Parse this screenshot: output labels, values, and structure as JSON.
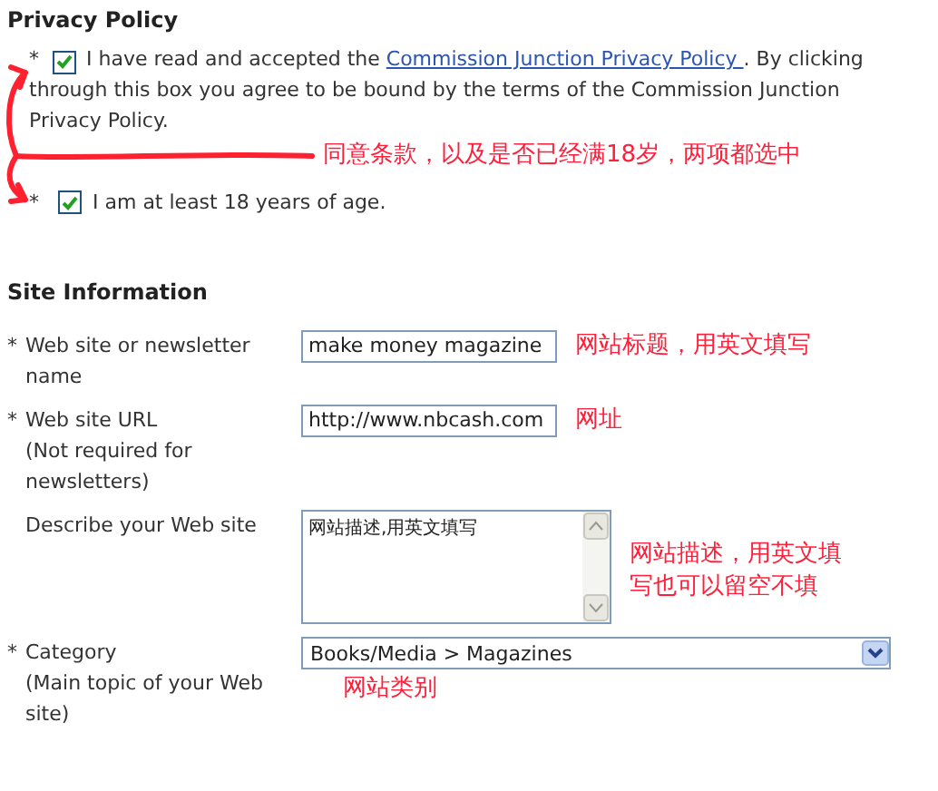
{
  "privacy": {
    "title": "Privacy Policy",
    "items": [
      {
        "kind": "linked",
        "marker": "*",
        "checked": true,
        "text_before": "I have read and accepted the ",
        "link": "Commission Junction Privacy Policy ",
        "text_after": ". By clicking through this box you agree to be bound by the terms of the Commission Junction Privacy Policy."
      },
      {
        "kind": "plain",
        "marker": "*",
        "checked": true,
        "text": "I am at least 18 years of age."
      }
    ],
    "note": "同意条款，以及是否已经满18岁，两项都选中"
  },
  "site_information": {
    "title": "Site Information",
    "fields": [
      {
        "kind": "input",
        "marker": "*",
        "label": "Web site or newsletter name",
        "value": "make money magazine",
        "note": "网站标题，用英文填写"
      },
      {
        "kind": "input",
        "marker": "*",
        "label": "Web site URL",
        "hint": "(Not required for newsletters)",
        "value": "http://www.nbcash.com",
        "note": "网址"
      },
      {
        "kind": "textarea",
        "label": "Describe your Web site",
        "value": "网站描述,用英文填写",
        "note": "网站描述，用英文填写也可以留空不填"
      },
      {
        "kind": "select",
        "marker": "*",
        "label": "Category",
        "hint": "(Main topic of your Web site)",
        "value": "Books/Media > Magazines",
        "note": "网站类别"
      }
    ]
  }
}
